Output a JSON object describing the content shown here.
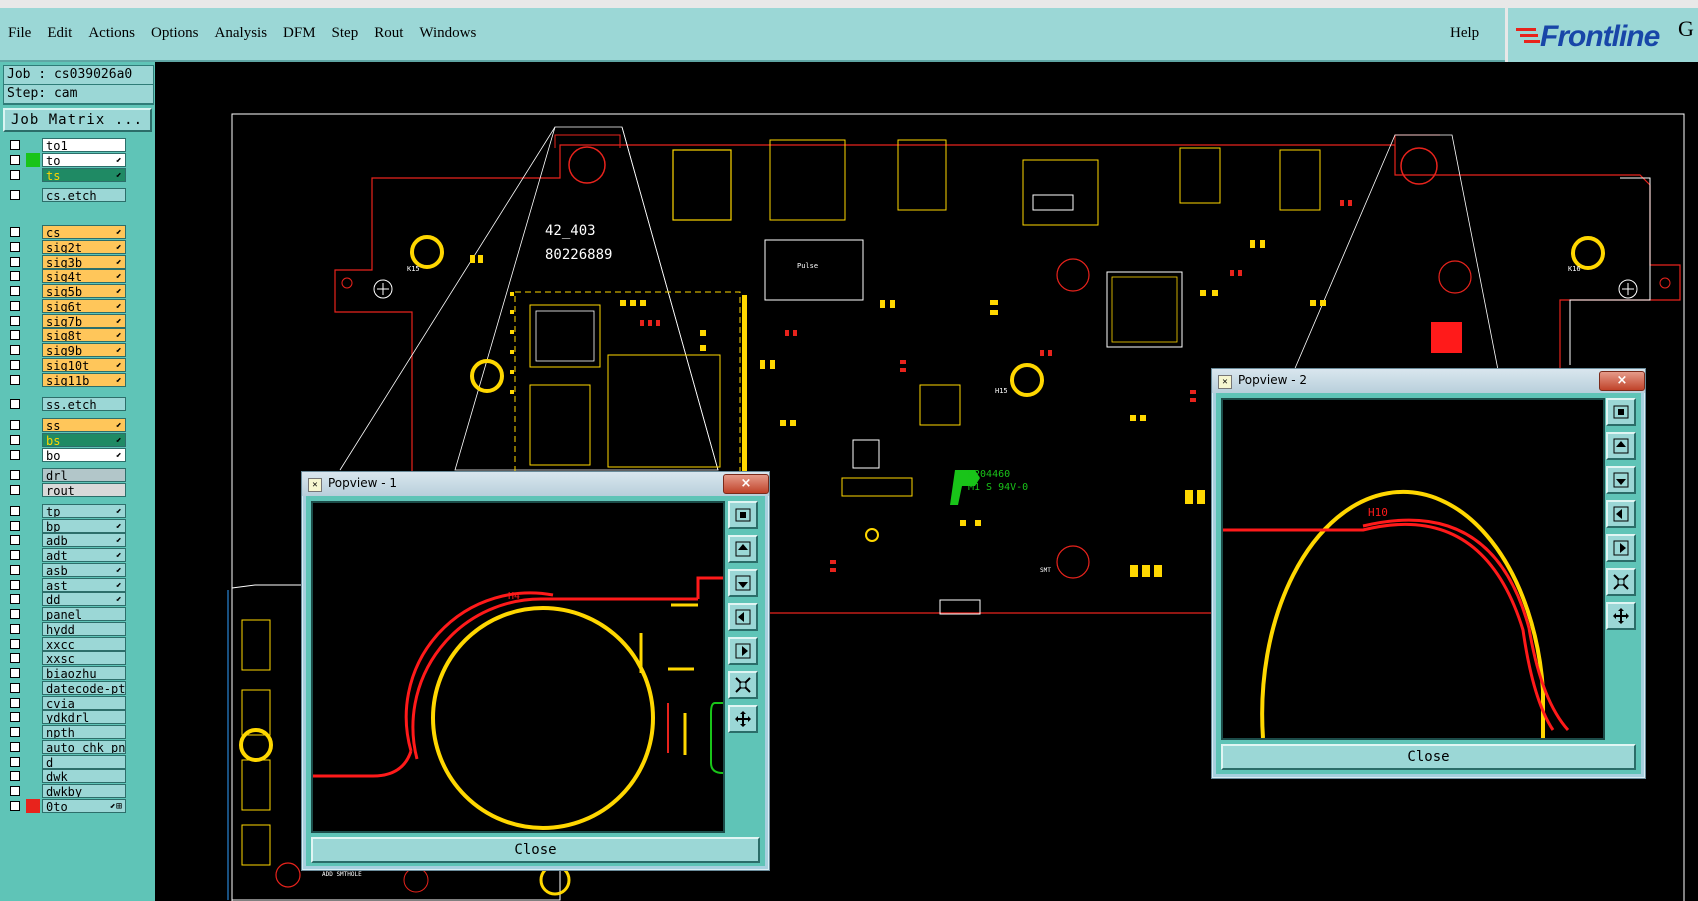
{
  "menu": {
    "items": [
      "File",
      "Edit",
      "Actions",
      "Options",
      "Analysis",
      "DFM",
      "Step",
      "Rout",
      "Windows"
    ],
    "help": "Help"
  },
  "logo": {
    "text": "Frontline",
    "extra": "G"
  },
  "job": {
    "job_line": "Job : cs039026a0",
    "step_line": "Step: cam",
    "matrix_button": "Job Matrix ..."
  },
  "layers": [
    {
      "name": "to1",
      "bg": "#ffffff",
      "swatch": "",
      "mark": ""
    },
    {
      "name": "to",
      "bg": "#ffffff",
      "swatch": "#19c419",
      "mark": "⬋"
    },
    {
      "name": "ts",
      "bg": "#1f8a64",
      "swatch": "",
      "mark": "⬋"
    },
    {
      "name": "cs.etch",
      "bg": "#9bd7d6",
      "swatch": "",
      "mark": ""
    },
    {
      "name": "cs",
      "bg": "#ffc65a",
      "swatch": "",
      "mark": "⬋"
    },
    {
      "name": "sig2t",
      "bg": "#ffc65a",
      "swatch": "",
      "mark": "⬋"
    },
    {
      "name": "sig3b",
      "bg": "#ffc65a",
      "swatch": "",
      "mark": "⬋"
    },
    {
      "name": "sig4t",
      "bg": "#ffc65a",
      "swatch": "",
      "mark": "⬋"
    },
    {
      "name": "sig5b",
      "bg": "#ffc65a",
      "swatch": "",
      "mark": "⬋"
    },
    {
      "name": "sig6t",
      "bg": "#ffc65a",
      "swatch": "",
      "mark": "⬋"
    },
    {
      "name": "sig7b",
      "bg": "#ffc65a",
      "swatch": "",
      "mark": "⬋"
    },
    {
      "name": "sig8t",
      "bg": "#ffc65a",
      "swatch": "",
      "mark": "⬋"
    },
    {
      "name": "sig9b",
      "bg": "#ffc65a",
      "swatch": "",
      "mark": "⬋"
    },
    {
      "name": "sig10t",
      "bg": "#ffc65a",
      "swatch": "",
      "mark": "⬋"
    },
    {
      "name": "sig11b",
      "bg": "#ffc65a",
      "swatch": "",
      "mark": "⬋"
    },
    {
      "name": "ss.etch",
      "bg": "#9bd7d6",
      "swatch": "",
      "mark": ""
    },
    {
      "name": "ss",
      "bg": "#ffc65a",
      "swatch": "",
      "mark": "⬋"
    },
    {
      "name": "bs",
      "bg": "#1f8a64",
      "swatch": "",
      "mark": "⬋"
    },
    {
      "name": "bo",
      "bg": "#ffffff",
      "swatch": "",
      "mark": "⬋"
    },
    {
      "name": "drl",
      "bg": "#b2c6c9",
      "swatch": "",
      "mark": ""
    },
    {
      "name": "rout",
      "bg": "#d9d9d9",
      "swatch": "",
      "mark": ""
    },
    {
      "name": "tp",
      "bg": "#9bd7d6",
      "swatch": "",
      "mark": "⬋"
    },
    {
      "name": "bp",
      "bg": "#9bd7d6",
      "swatch": "",
      "mark": "⬋"
    },
    {
      "name": "adb",
      "bg": "#9bd7d6",
      "swatch": "",
      "mark": "⬋"
    },
    {
      "name": "adt",
      "bg": "#9bd7d6",
      "swatch": "",
      "mark": "⬋"
    },
    {
      "name": "asb",
      "bg": "#9bd7d6",
      "swatch": "",
      "mark": "⬋"
    },
    {
      "name": "ast",
      "bg": "#9bd7d6",
      "swatch": "",
      "mark": "⬋"
    },
    {
      "name": "dd",
      "bg": "#9bd7d6",
      "swatch": "",
      "mark": "⬋"
    },
    {
      "name": "panel",
      "bg": "#9bd7d6",
      "swatch": "",
      "mark": ""
    },
    {
      "name": "hydd",
      "bg": "#9bd7d6",
      "swatch": "",
      "mark": ""
    },
    {
      "name": "xxcc",
      "bg": "#9bd7d6",
      "swatch": "",
      "mark": ""
    },
    {
      "name": "xxsc",
      "bg": "#9bd7d6",
      "swatch": "",
      "mark": ""
    },
    {
      "name": "biaozhu",
      "bg": "#9bd7d6",
      "swatch": "",
      "mark": ""
    },
    {
      "name": "datecode-ptc",
      "bg": "#9bd7d6",
      "swatch": "",
      "mark": ""
    },
    {
      "name": "cvia",
      "bg": "#9bd7d6",
      "swatch": "",
      "mark": ""
    },
    {
      "name": "ydkdrl",
      "bg": "#9bd7d6",
      "swatch": "",
      "mark": ""
    },
    {
      "name": "npth",
      "bg": "#9bd7d6",
      "swatch": "",
      "mark": ""
    },
    {
      "name": "auto_chk_pn...",
      "bg": "#9bd7d6",
      "swatch": "",
      "mark": ""
    },
    {
      "name": "d",
      "bg": "#9bd7d6",
      "swatch": "",
      "mark": ""
    },
    {
      "name": "dwk",
      "bg": "#9bd7d6",
      "swatch": "",
      "mark": ""
    },
    {
      "name": "dwkby",
      "bg": "#9bd7d6",
      "swatch": "",
      "mark": ""
    },
    {
      "name": "0to",
      "bg": "#9bd7d6",
      "swatch": "#e8231c",
      "mark": "⬋⊞"
    }
  ],
  "board": {
    "labels": {
      "code1": "42_403",
      "code2": "80226889",
      "pulse": "Pulse",
      "ul_line1": "E204460",
      "ul_line2": "M1 S 94V-0",
      "mark_h10": "H10",
      "mark_h4": "H4",
      "mark_k15": "K15",
      "mark_k16": "K16",
      "mark_h15": "H15",
      "add_smthole": "ADD SMTHOLE",
      "smt": "SMT"
    }
  },
  "popview1": {
    "title": "Popview - 1",
    "close_x": "×",
    "label": "H4",
    "close_button": "Close"
  },
  "popview2": {
    "title": "Popview - 2",
    "close_x": "×",
    "label": "H10",
    "close_button": "Close"
  },
  "colors": {
    "accent": "#9bd7d6",
    "panel": "#5fc4b7",
    "outline": "#e8231c",
    "pad": "#ffd700",
    "silk": "#ffffff"
  }
}
